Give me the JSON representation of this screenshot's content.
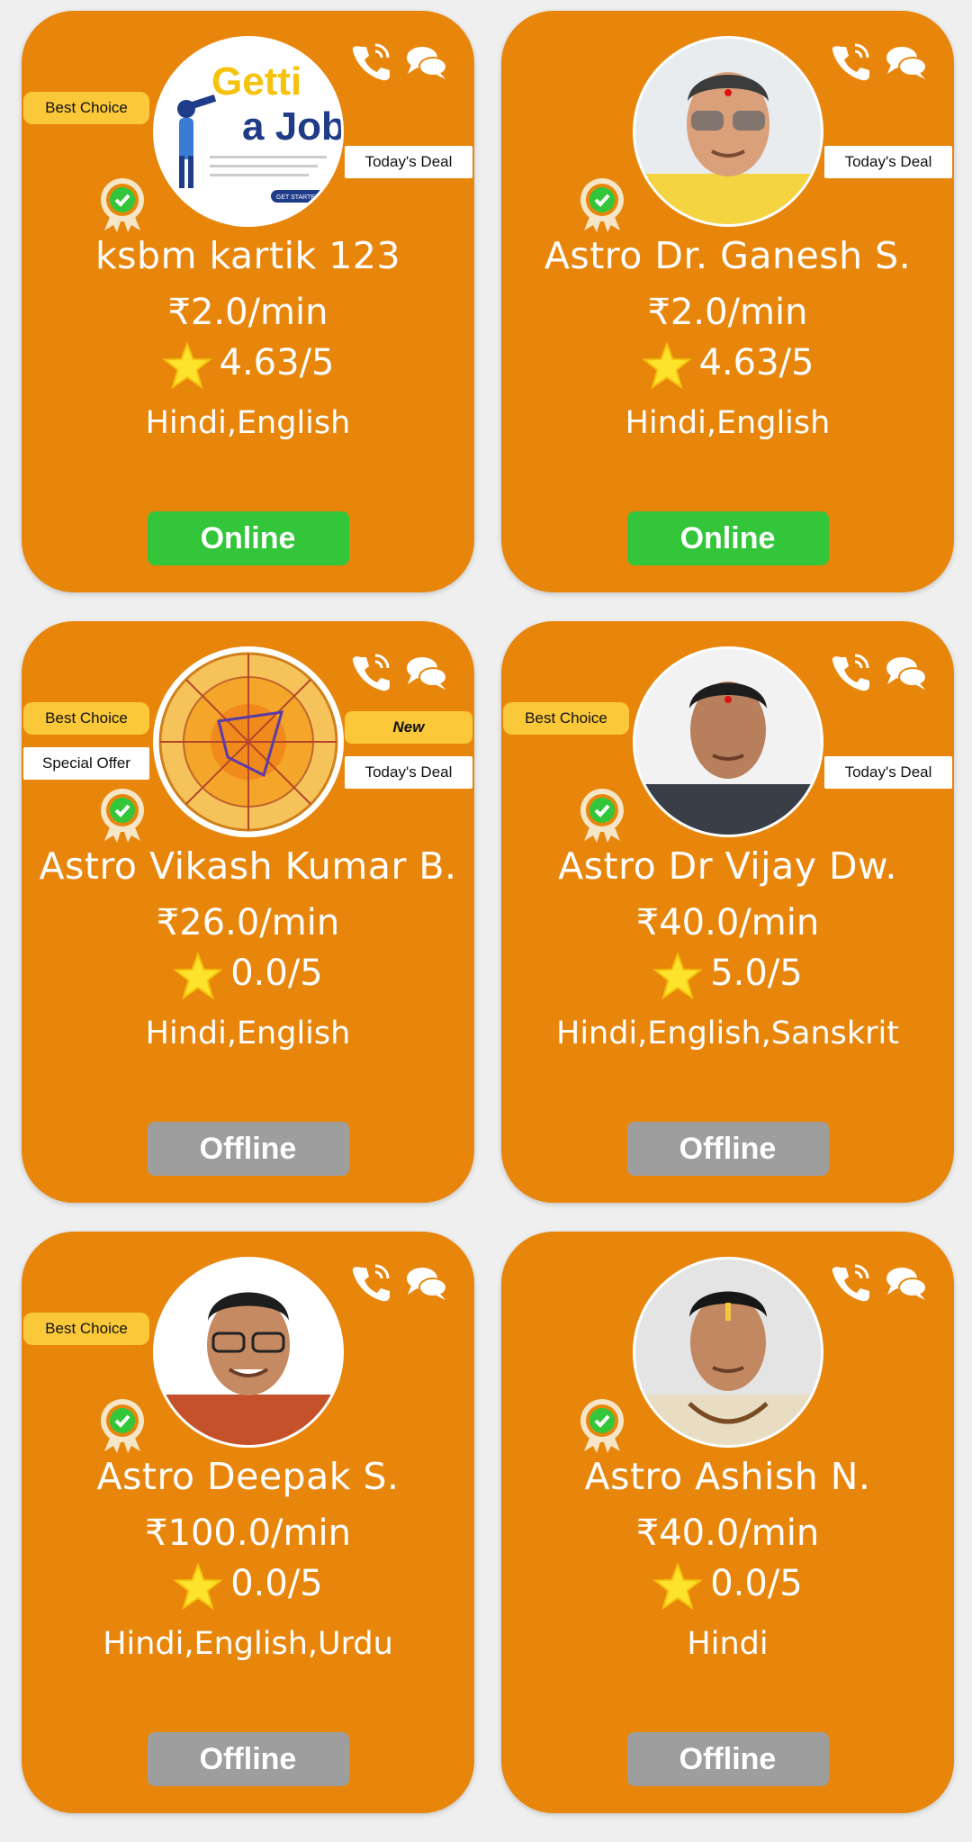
{
  "colors": {
    "card": "#e8860c",
    "online": "#33c63a",
    "offline": "#9e9e9e",
    "badge_yellow": "#fbc83a"
  },
  "icons": [
    "phone-icon",
    "chat-icon",
    "verified-badge-icon",
    "star-icon"
  ],
  "cards": [
    {
      "name": "ksbm kartik 123",
      "price": "₹2.0/min",
      "rating": "4.63/5",
      "languages": "Hindi,English",
      "status": "Online",
      "best_choice": "Best Choice",
      "todays_deal": "Today's Deal",
      "avatar_text_1": "Getti",
      "avatar_text_2": "a Job",
      "avatar_button": "GET STARTED"
    },
    {
      "name": "Astro Dr. Ganesh S.",
      "price": "₹2.0/min",
      "rating": "4.63/5",
      "languages": "Hindi,English",
      "status": "Online",
      "todays_deal": "Today's Deal"
    },
    {
      "name": "Astro Vikash Kumar B.",
      "price": "₹26.0/min",
      "rating": "0.0/5",
      "languages": "Hindi,English",
      "status": "Offline",
      "best_choice": "Best Choice",
      "special_offer": "Special Offer",
      "new_label": "New",
      "todays_deal": "Today's Deal"
    },
    {
      "name": "Astro Dr Vijay Dw.",
      "price": "₹40.0/min",
      "rating": "5.0/5",
      "languages": "Hindi,English,Sanskrit",
      "status": "Offline",
      "best_choice": "Best Choice",
      "todays_deal": "Today's Deal"
    },
    {
      "name": "Astro Deepak S.",
      "price": "₹100.0/min",
      "rating": "0.0/5",
      "languages": "Hindi,English,Urdu",
      "status": "Offline",
      "best_choice": "Best Choice"
    },
    {
      "name": "Astro Ashish N.",
      "price": "₹40.0/min",
      "rating": "0.0/5",
      "languages": "Hindi",
      "status": "Offline"
    }
  ]
}
